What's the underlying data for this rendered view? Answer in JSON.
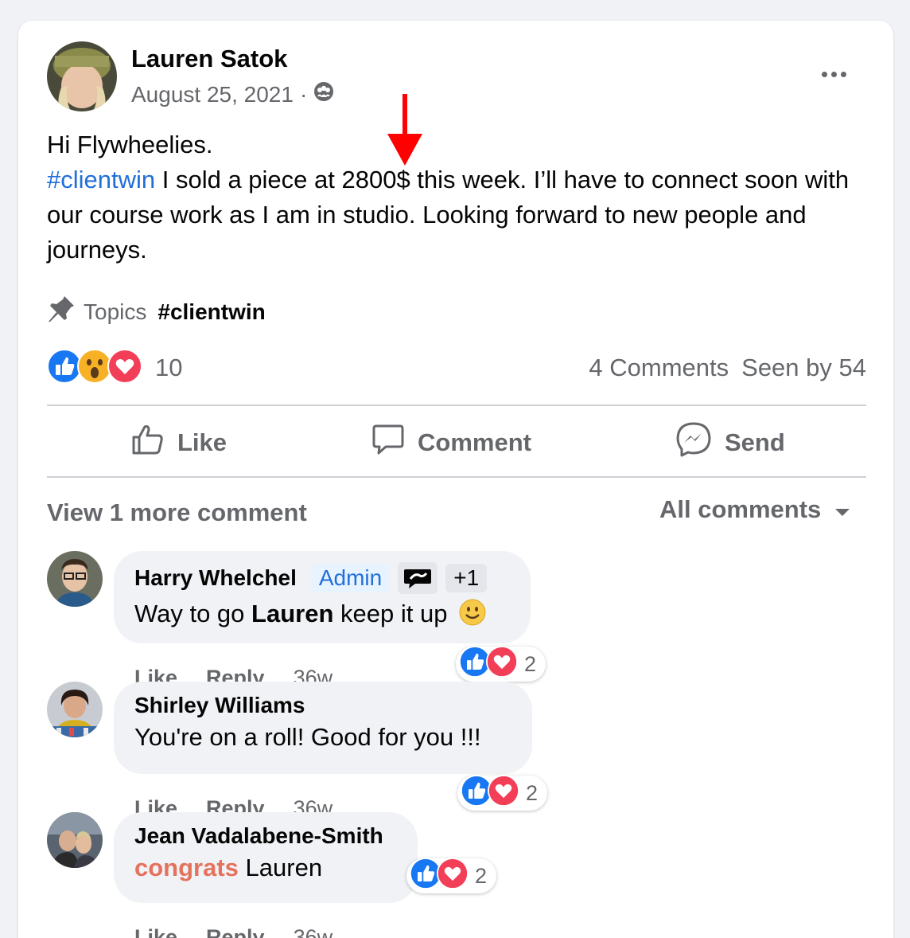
{
  "post": {
    "author": "Lauren Satok",
    "date": "August 25, 2021",
    "separator": "·",
    "icon_audience": "group-audience-icon",
    "more_icon": "more-options-icon",
    "greeting": "Hi Flywheelies.",
    "hashtag": "#clientwin",
    "body": " I sold a piece at 2800$ this week. I’ll have to connect soon with our course work as I am in studio. Looking forward to new people and journeys.",
    "topics_label": "Topics",
    "topics_tag": "#clientwin",
    "reaction_count": "10",
    "comments_count": "4 Comments",
    "seen_by": "Seen by 54"
  },
  "actions": {
    "like": "Like",
    "comment": "Comment",
    "send": "Send"
  },
  "comments_section": {
    "view_more": "View 1 more comment",
    "filter": "All comments"
  },
  "comments": [
    {
      "name": "Harry Whelchel",
      "badge": "Admin",
      "badge_extra": "+1",
      "text_before": "Way to go ",
      "text_bold": "Lauren",
      "text_after": " keep it up",
      "emoji": "🙂",
      "reactions": "2",
      "like": "Like",
      "reply": "Reply",
      "time": "36w"
    },
    {
      "name": "Shirley Williams",
      "text": "You're on a roll! Good for you !!!",
      "reactions": "2",
      "like": "Like",
      "reply": "Reply",
      "time": "36w"
    },
    {
      "name": "Jean Vadalabene-Smith",
      "text_highlight": "congrats",
      "text_after": " Lauren",
      "reactions": "2",
      "like": "Like",
      "reply": "Reply",
      "time": "36w"
    }
  ],
  "colors": {
    "link": "#216fdb",
    "secondary_text": "#65676b",
    "arrow": "#ff0000",
    "like_blue": "#1877f2",
    "love_red": "#f33e58",
    "congrats_orange": "#e4725c"
  }
}
